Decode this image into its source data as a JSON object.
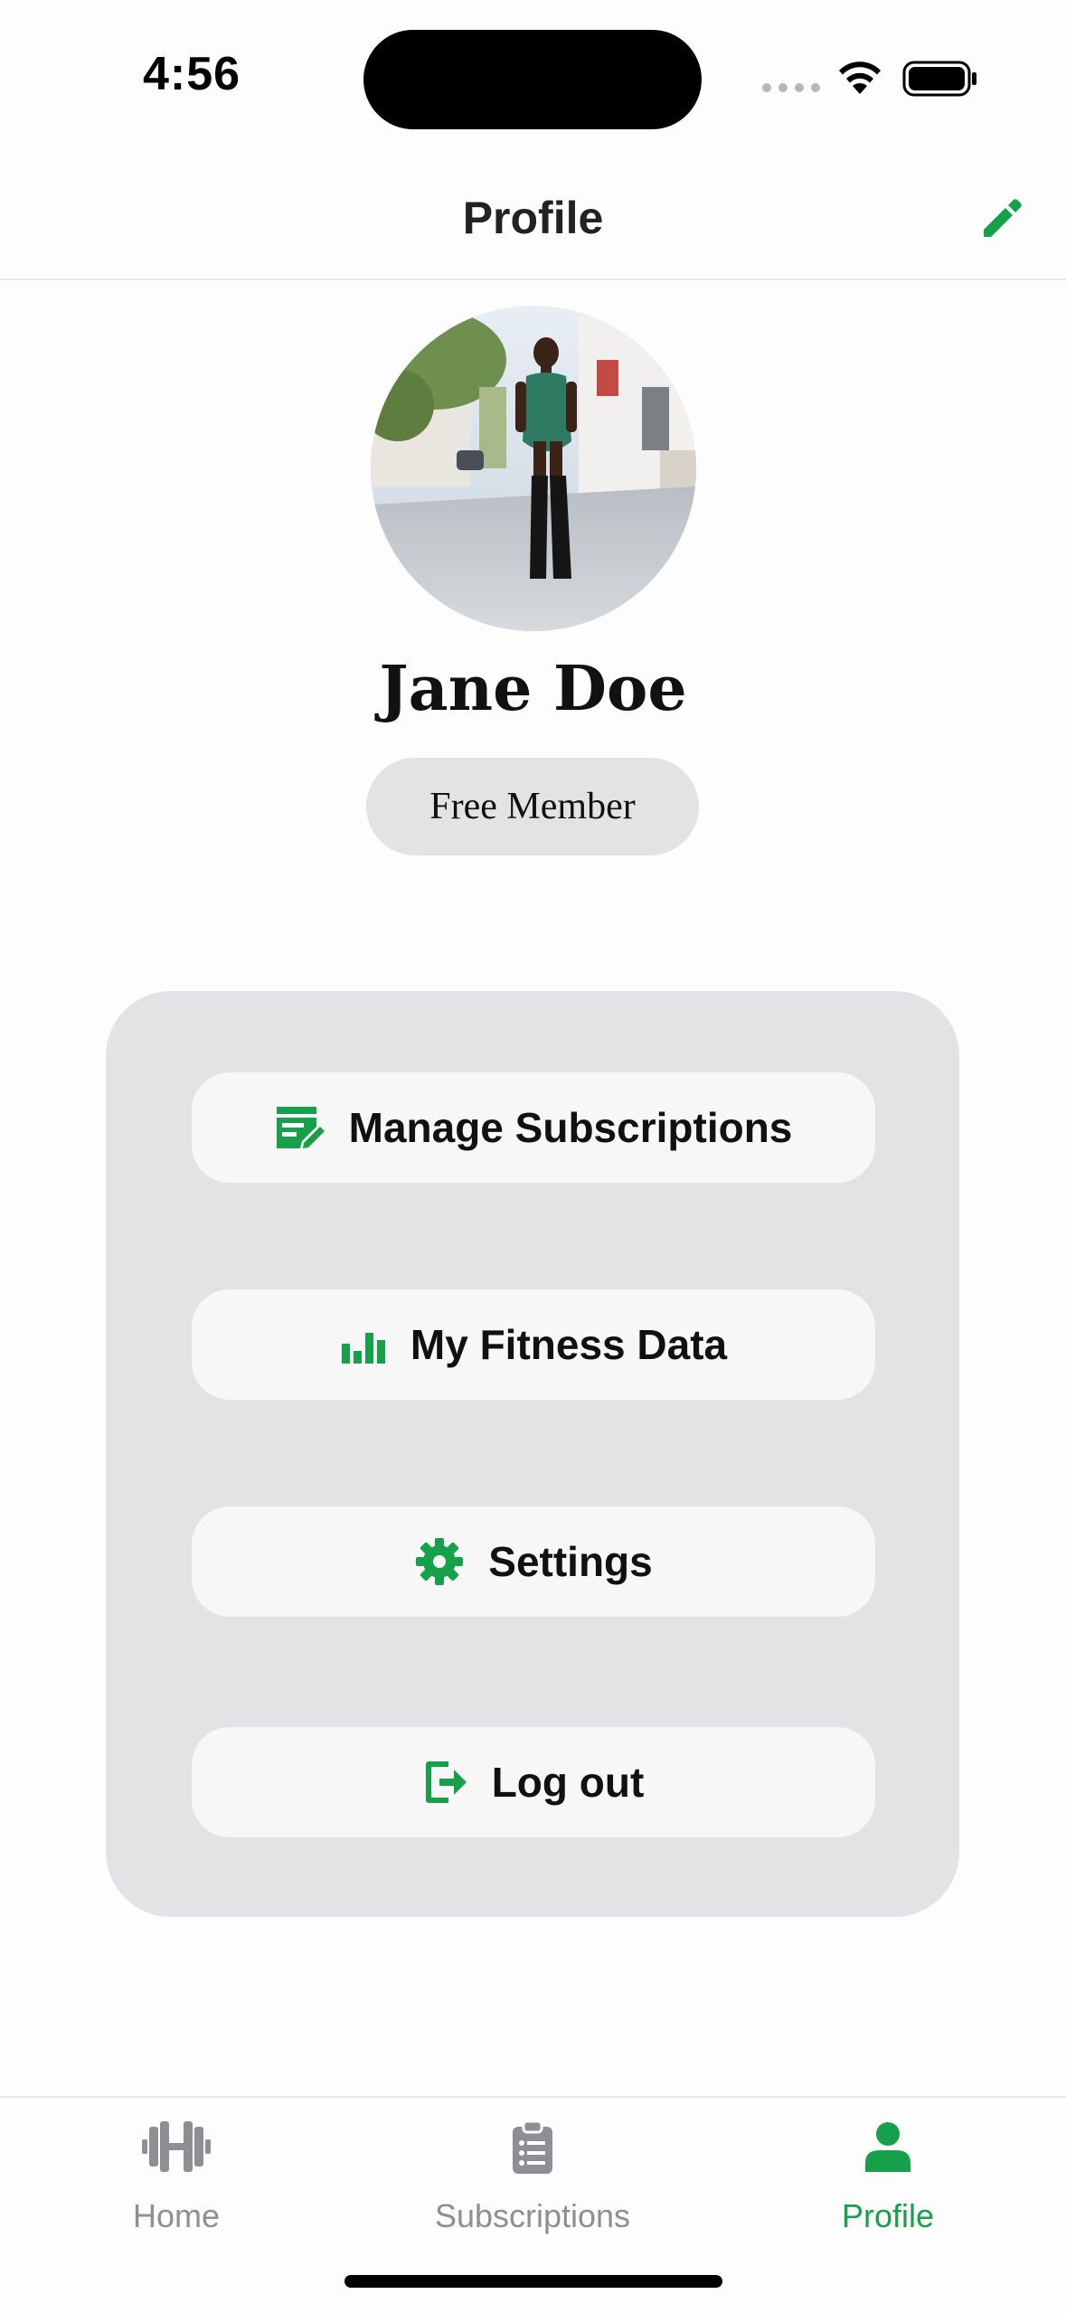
{
  "status_bar": {
    "time": "4:56"
  },
  "header": {
    "title": "Profile",
    "edit_icon": "pencil-icon"
  },
  "profile": {
    "name": "Jane Doe",
    "membership": "Free Member",
    "avatar_alt": "profile photo"
  },
  "menu": {
    "items": [
      {
        "label": "Manage Subscriptions",
        "icon": "subscription-edit-icon"
      },
      {
        "label": "My Fitness Data",
        "icon": "bar-chart-icon"
      },
      {
        "label": "Settings",
        "icon": "gear-icon"
      },
      {
        "label": "Log out",
        "icon": "logout-icon"
      }
    ]
  },
  "tabs": [
    {
      "label": "Home",
      "icon": "dumbbell-icon",
      "active": false
    },
    {
      "label": "Subscriptions",
      "icon": "clipboard-icon",
      "active": false
    },
    {
      "label": "Profile",
      "icon": "person-icon",
      "active": true
    }
  ],
  "colors": {
    "accent": "#16a04a",
    "inactive": "#8e8e93",
    "card": "#e3e3e5",
    "button": "#f7f7f7"
  }
}
